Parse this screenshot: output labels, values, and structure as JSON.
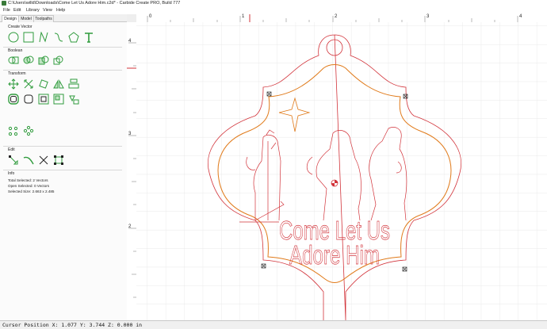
{
  "window": {
    "title": "C:\\Users\\willd\\Downloads\\Come Let Us Adore Him.c2d* - Carbide Create PRO, Build 777"
  },
  "menu": {
    "file": "File",
    "edit": "Edit",
    "library": "Library",
    "view": "View",
    "help": "Help"
  },
  "tabs": {
    "design": "Design",
    "model": "Model",
    "toolpaths": "Toolpaths"
  },
  "sections": {
    "create_vector": "Create Vector",
    "boolean": "Boolean",
    "transform": "Transform",
    "edit": "Edit",
    "info": "Info"
  },
  "info": {
    "total_selected": "Total Selected:  2 Vectors",
    "open_selected": "Open Selected:   0 Vectors",
    "selected_size": "Selected Size:   2.663 x 2.485"
  },
  "ruler": {
    "top": [
      "0",
      "1",
      "2",
      "3",
      "4"
    ],
    "left": [
      "4",
      "3",
      "2"
    ]
  },
  "design": {
    "text_line1": "Come Let Us",
    "text_line2": "Adore Him"
  },
  "status": {
    "cursor": "Cursor Position X: 1.077 Y: 3.744 Z: 0.000 in"
  },
  "colors": {
    "vector": "#d2333a",
    "selected": "#e07a1a",
    "icon": "#2f9b3c",
    "grid": "#e3e3e3"
  }
}
